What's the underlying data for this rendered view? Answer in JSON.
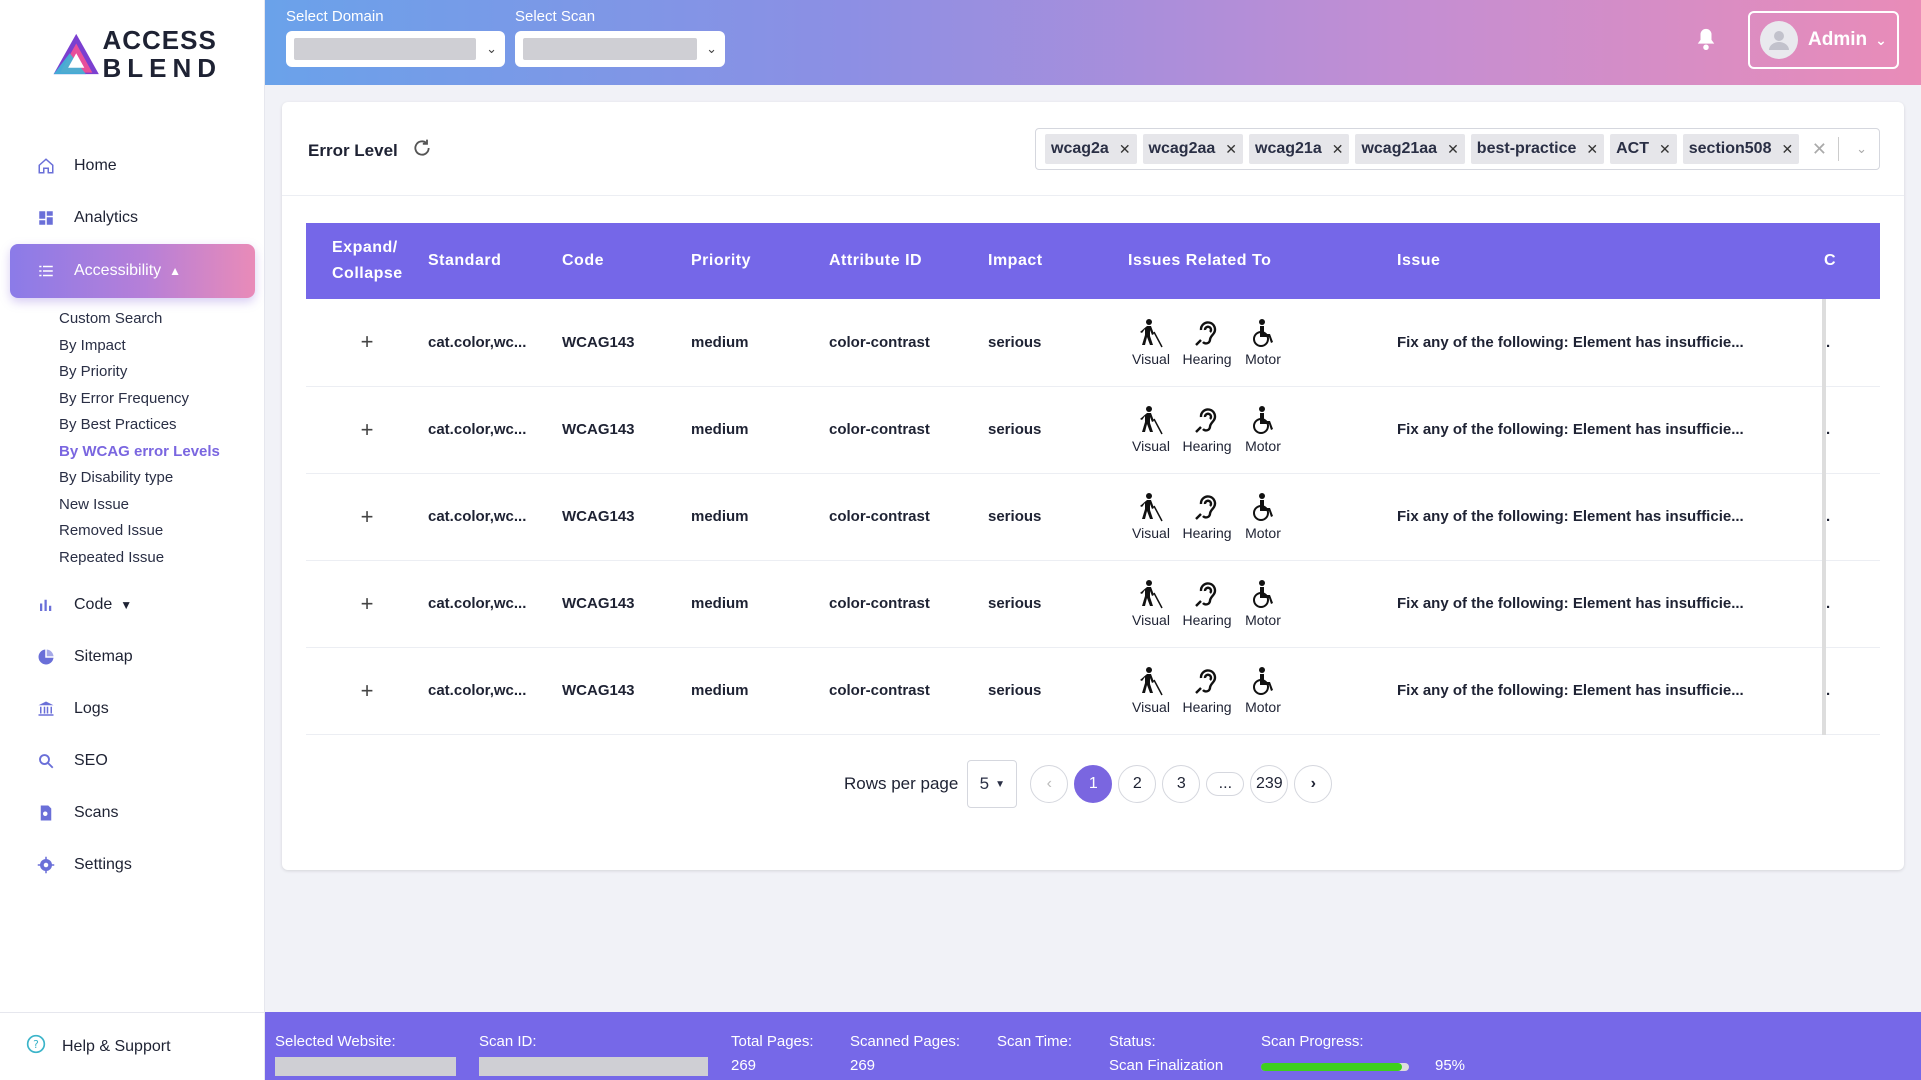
{
  "brand": {
    "line1": "ACCESS",
    "line2": "BLEND"
  },
  "nav": {
    "home": "Home",
    "analytics": "Analytics",
    "accessibility": "Accessibility",
    "sub": [
      "Custom Search",
      "By Impact",
      "By Priority",
      "By Error Frequency",
      "By Best Practices",
      "By WCAG error Levels",
      "By Disability type",
      "New Issue",
      "Removed Issue",
      "Repeated Issue"
    ],
    "code": "Code",
    "sitemap": "Sitemap",
    "logs": "Logs",
    "seo": "SEO",
    "scans": "Scans",
    "settings": "Settings",
    "help": "Help & Support"
  },
  "top": {
    "domain_label": "Select Domain",
    "scan_label": "Select Scan",
    "user": "Admin"
  },
  "panel": {
    "title": "Error Level",
    "tags": [
      "wcag2a",
      "wcag2aa",
      "wcag21a",
      "wcag21aa",
      "best-practice",
      "ACT",
      "section508"
    ]
  },
  "table": {
    "headers": [
      "Expand/ Collapse",
      "Standard",
      "Code",
      "Priority",
      "Attribute ID",
      "Impact",
      "Issues Related To",
      "Issue",
      "C"
    ],
    "related": [
      "Visual",
      "Hearing",
      "Motor"
    ],
    "rows": [
      {
        "expand": "+",
        "standard": "cat.color,wc...",
        "code": "WCAG143",
        "priority": "medium",
        "attr": "color-contrast",
        "impact": "serious",
        "issue": "Fix any of the following: Element has insufficie...",
        "extra": "."
      },
      {
        "expand": "+",
        "standard": "cat.color,wc...",
        "code": "WCAG143",
        "priority": "medium",
        "attr": "color-contrast",
        "impact": "serious",
        "issue": "Fix any of the following: Element has insufficie...",
        "extra": "."
      },
      {
        "expand": "+",
        "standard": "cat.color,wc...",
        "code": "WCAG143",
        "priority": "medium",
        "attr": "color-contrast",
        "impact": "serious",
        "issue": "Fix any of the following: Element has insufficie...",
        "extra": "."
      },
      {
        "expand": "+",
        "standard": "cat.color,wc...",
        "code": "WCAG143",
        "priority": "medium",
        "attr": "color-contrast",
        "impact": "serious",
        "issue": "Fix any of the following: Element has insufficie...",
        "extra": "."
      },
      {
        "expand": "+",
        "standard": "cat.color,wc...",
        "code": "WCAG143",
        "priority": "medium",
        "attr": "color-contrast",
        "impact": "serious",
        "issue": "Fix any of the following: Element has insufficie...",
        "extra": "."
      }
    ]
  },
  "pager": {
    "label": "Rows per page",
    "rows": "5",
    "pages": [
      "1",
      "2",
      "3",
      "...",
      "239"
    ],
    "current": "1"
  },
  "footer": {
    "website_label": "Selected Website:",
    "scanid_label": "Scan ID:",
    "total_label": "Total Pages:",
    "total": "269",
    "scanned_label": "Scanned Pages:",
    "scanned": "269",
    "time_label": "Scan Time:",
    "status_label": "Status:",
    "status": "Scan Finalization",
    "progress_label": "Scan Progress:",
    "progress": 0.95,
    "progress_text": "95%"
  },
  "colors": {
    "accent": "#7567e8",
    "progress": "#3ecf1c"
  }
}
